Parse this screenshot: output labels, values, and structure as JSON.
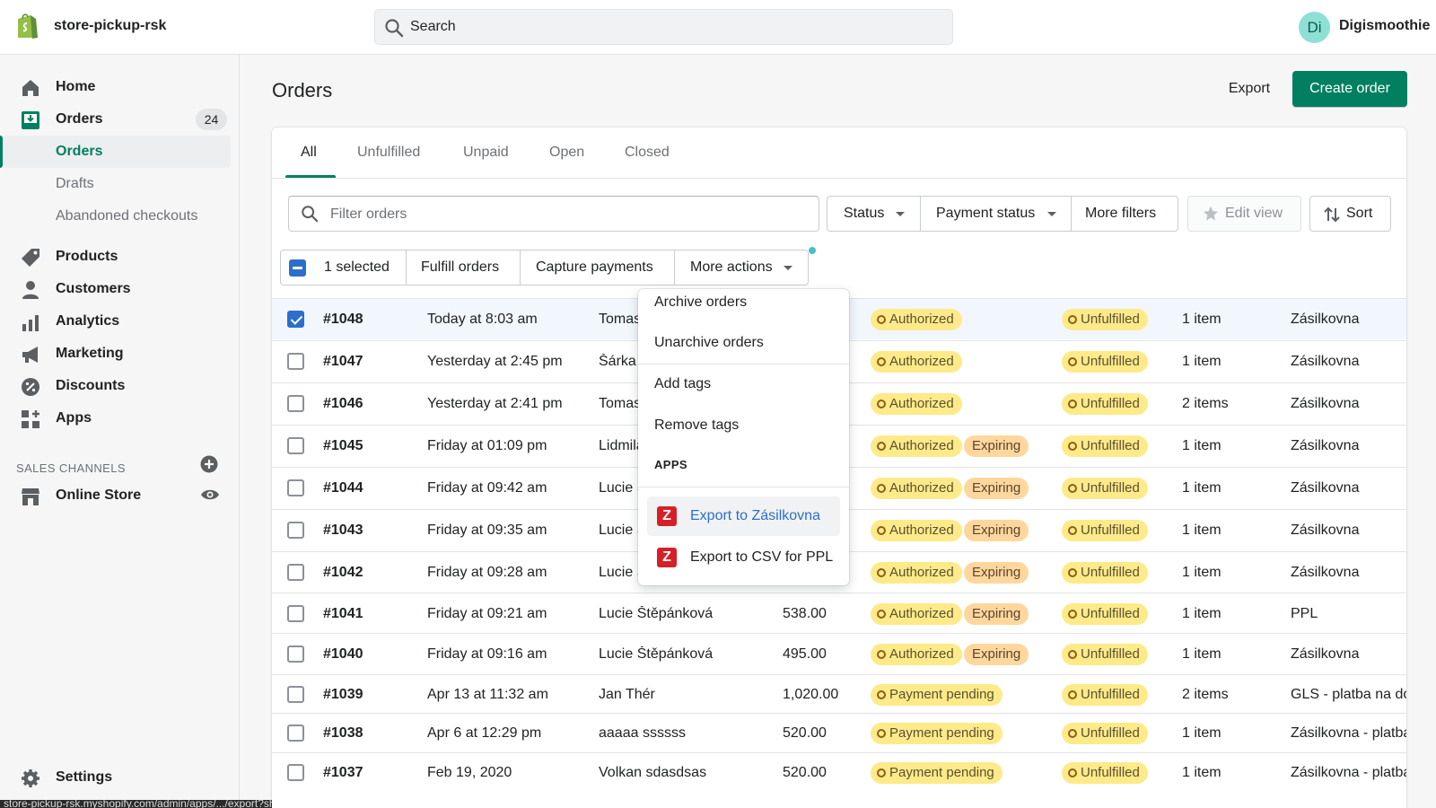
{
  "header": {
    "store_name": "store-pickup-rsk",
    "search_placeholder": "Search",
    "avatar_initials": "Di",
    "user_name": "Digismoothie"
  },
  "sidebar": {
    "items": [
      {
        "label": "Home",
        "icon": "home-icon"
      },
      {
        "label": "Orders",
        "icon": "orders-icon",
        "badge": "24"
      },
      {
        "label": "Products",
        "icon": "tag-icon"
      },
      {
        "label": "Customers",
        "icon": "person-icon"
      },
      {
        "label": "Analytics",
        "icon": "bar-chart-icon"
      },
      {
        "label": "Marketing",
        "icon": "megaphone-icon"
      },
      {
        "label": "Discounts",
        "icon": "discount-icon"
      },
      {
        "label": "Apps",
        "icon": "apps-icon"
      }
    ],
    "orders_sub": [
      "Orders",
      "Drafts",
      "Abandoned checkouts"
    ],
    "sales_channels_heading": "SALES CHANNELS",
    "online_store": "Online Store",
    "settings": "Settings",
    "status_url": "store-pickup-rsk.myshopify.com/admin/apps/.../export?shop=store-pickup-rsk"
  },
  "page": {
    "title": "Orders",
    "export_label": "Export",
    "create_label": "Create order"
  },
  "tabs": [
    "All",
    "Unfulfilled",
    "Unpaid",
    "Open",
    "Closed"
  ],
  "filters": {
    "placeholder": "Filter orders",
    "status": "Status",
    "payment_status": "Payment status",
    "more_filters": "More filters",
    "edit_view": "Edit view",
    "sort": "Sort"
  },
  "bulk": {
    "selected": "1 selected",
    "fulfill": "Fulfill orders",
    "capture": "Capture payments",
    "more": "More actions"
  },
  "menu": {
    "archive": "Archive orders",
    "unarchive": "Unarchive orders",
    "add_tags": "Add tags",
    "remove_tags": "Remove tags",
    "apps_heading": "APPS",
    "app1": "Export to Zásilkovna",
    "app2": "Export to CSV for PPL"
  },
  "orders": [
    {
      "id": "#1048",
      "date": "Today at 8:03 am",
      "customer": "Tomas",
      "total": "",
      "payment": "Authorized",
      "expiring": "",
      "fulfillment": "Unfulfilled",
      "items": "1 item",
      "delivery": "Zásilkovna",
      "selected": true
    },
    {
      "id": "#1047",
      "date": "Yesterday at 2:45 pm",
      "customer": "Šárka",
      "total": "",
      "payment": "Authorized",
      "expiring": "",
      "fulfillment": "Unfulfilled",
      "items": "1 item",
      "delivery": "Zásilkovna",
      "selected": false
    },
    {
      "id": "#1046",
      "date": "Yesterday at 2:41 pm",
      "customer": "Tomas",
      "total": "",
      "payment": "Authorized",
      "expiring": "",
      "fulfillment": "Unfulfilled",
      "items": "2 items",
      "delivery": "Zásilkovna",
      "selected": false
    },
    {
      "id": "#1045",
      "date": "Friday at 01:09 pm",
      "customer": "Lidmila",
      "total": "",
      "payment": "Authorized",
      "expiring": "Expiring",
      "fulfillment": "Unfulfilled",
      "items": "1 item",
      "delivery": "Zásilkovna",
      "selected": false
    },
    {
      "id": "#1044",
      "date": "Friday at 09:42 am",
      "customer": "Lucie Š",
      "total": "",
      "payment": "Authorized",
      "expiring": "Expiring",
      "fulfillment": "Unfulfilled",
      "items": "1 item",
      "delivery": "Zásilkovna",
      "selected": false
    },
    {
      "id": "#1043",
      "date": "Friday at 09:35 am",
      "customer": "Lucie Š",
      "total": "",
      "payment": "Authorized",
      "expiring": "Expiring",
      "fulfillment": "Unfulfilled",
      "items": "1 item",
      "delivery": "Zásilkovna",
      "selected": false
    },
    {
      "id": "#1042",
      "date": "Friday at 09:28 am",
      "customer": "Lucie Š",
      "total": "",
      "payment": "Authorized",
      "expiring": "Expiring",
      "fulfillment": "Unfulfilled",
      "items": "1 item",
      "delivery": "Zásilkovna",
      "selected": false
    },
    {
      "id": "#1041",
      "date": "Friday at 09:21 am",
      "customer": "Lucie Štěpánková",
      "total": "538.00",
      "payment": "Authorized",
      "expiring": "Expiring",
      "fulfillment": "Unfulfilled",
      "items": "1 item",
      "delivery": "PPL",
      "selected": false
    },
    {
      "id": "#1040",
      "date": "Friday at 09:16 am",
      "customer": "Lucie Štěpánková",
      "total": "495.00",
      "payment": "Authorized",
      "expiring": "Expiring",
      "fulfillment": "Unfulfilled",
      "items": "1 item",
      "delivery": "Zásilkovna",
      "selected": false
    },
    {
      "id": "#1039",
      "date": "Apr 13 at 11:32 am",
      "customer": "Jan Thér",
      "total": "1,020.00",
      "payment": "Payment pending",
      "expiring": "",
      "fulfillment": "Unfulfilled",
      "items": "2 items",
      "delivery": "GLS - platba na dobírku",
      "selected": false
    },
    {
      "id": "#1038",
      "date": "Apr 6 at 12:29 pm",
      "customer": "aaaaa ssssss",
      "total": "520.00",
      "payment": "Payment pending",
      "expiring": "",
      "fulfillment": "Unfulfilled",
      "items": "1 item",
      "delivery": "Zásilkovna - platba",
      "selected": false
    },
    {
      "id": "#1037",
      "date": "Feb 19, 2020",
      "customer": "Volkan sdasdsas",
      "total": "520.00",
      "payment": "Payment pending",
      "expiring": "",
      "fulfillment": "Unfulfilled",
      "items": "1 item",
      "delivery": "Zásilkovna - platba",
      "selected": false
    }
  ],
  "colors": {
    "accent": "#008060",
    "selection": "#2c6ecb",
    "authorized_badge": "#ffea8a",
    "expiring_badge": "#ffd79d"
  }
}
